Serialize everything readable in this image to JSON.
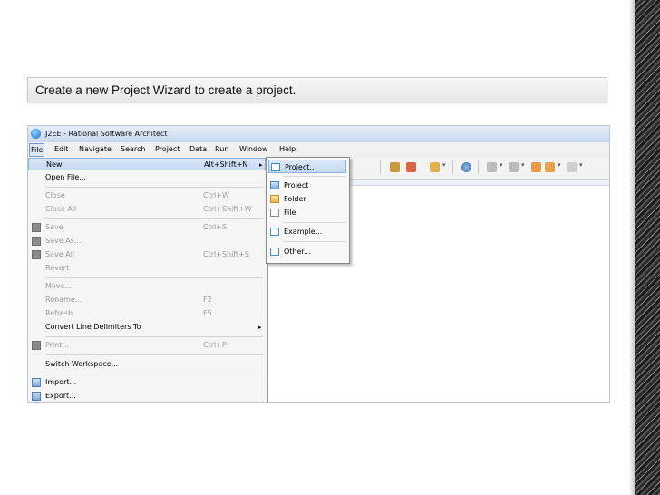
{
  "caption": "Create a new Project Wizard to create a project.",
  "window": {
    "title": "J2EE - Rational Software Architect"
  },
  "menubar": [
    "File",
    "Edit",
    "Navigate",
    "Search",
    "Project",
    "Data",
    "Run",
    "Window",
    "Help"
  ],
  "file_menu": [
    {
      "label": "New",
      "accel": "Alt+Shift+N",
      "submenu": "▸"
    },
    {
      "label": "Open File...",
      "accel": ""
    },
    {
      "label": "Close",
      "accel": "Ctrl+W"
    },
    {
      "label": "Close All",
      "accel": "Ctrl+Shift+W"
    },
    {
      "label": "Save",
      "accel": "Ctrl+S"
    },
    {
      "label": "Save As...",
      "accel": ""
    },
    {
      "label": "Save All",
      "accel": "Ctrl+Shift+S"
    },
    {
      "label": "Revert",
      "accel": ""
    },
    {
      "label": "Move...",
      "accel": ""
    },
    {
      "label": "Rename...",
      "accel": "F2"
    },
    {
      "label": "Refresh",
      "accel": "F5"
    },
    {
      "label": "Convert Line Delimiters To",
      "accel": "",
      "submenu": "▸"
    },
    {
      "label": "Print...",
      "accel": "Ctrl+P"
    },
    {
      "label": "Switch Workspace...",
      "accel": ""
    },
    {
      "label": "Import...",
      "accel": ""
    },
    {
      "label": "Export...",
      "accel": ""
    }
  ],
  "new_submenu": [
    "Project...",
    "Project",
    "Folder",
    "File",
    "Example...",
    "Other..."
  ],
  "toolbar_arrow": "▾",
  "colors": {
    "selection": "#c5daf3",
    "accent": "#1b6fc0"
  },
  "icons": [
    "app-icon",
    "wizard-icon",
    "project-icon",
    "folder-icon",
    "file-icon",
    "example-icon",
    "other-icon",
    "save-icon",
    "print-icon",
    "import-icon",
    "export-icon"
  ]
}
